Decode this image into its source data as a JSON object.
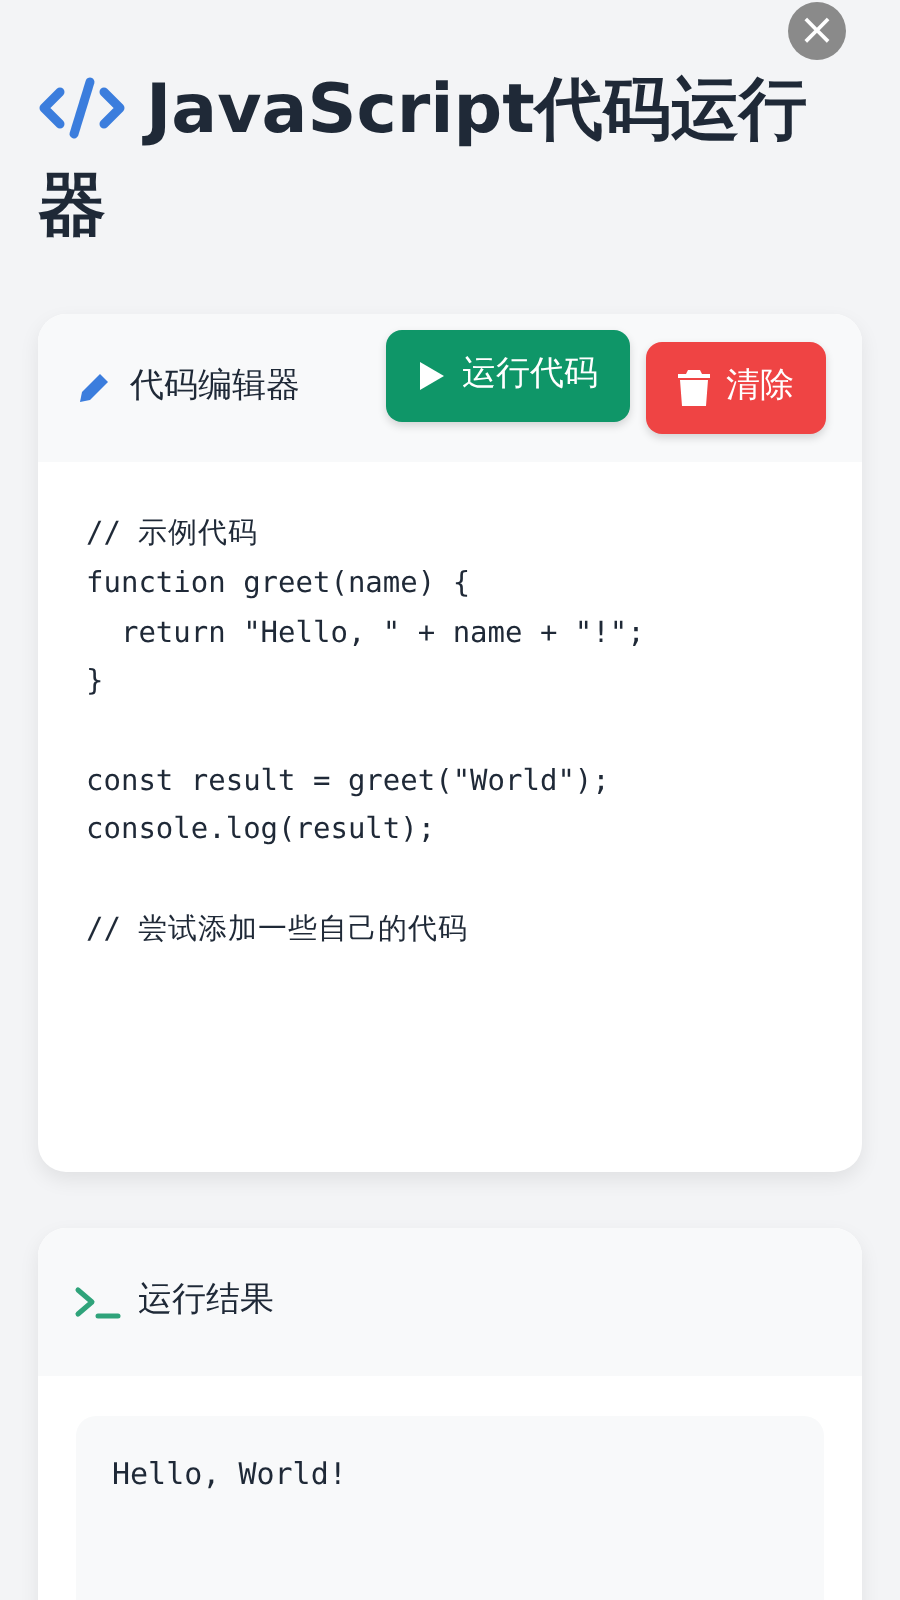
{
  "title": "JavaScript代码运行器",
  "editor": {
    "title": "代码编辑器",
    "buttons": [
      {
        "kind": "run",
        "label": "运行代码"
      },
      {
        "kind": "clear",
        "label": "清除"
      }
    ],
    "code_blocks": [
      [
        "// 示例代码",
        "function greet(name) {",
        "  return \"Hello, \" + name + \"!\";",
        "}"
      ],
      [
        "const result = greet(\"World\");",
        "console.log(result);"
      ],
      [
        "// 尝试添加一些自己的代码"
      ]
    ]
  },
  "output": {
    "title": "运行结果",
    "text": "Hello, World!"
  },
  "close_button": "×"
}
